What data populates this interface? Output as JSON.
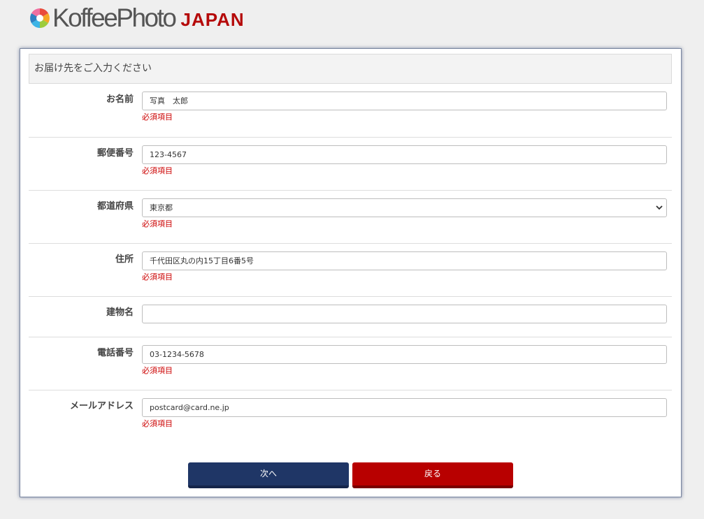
{
  "brand": {
    "logo_text": "KoffeePhoto",
    "logo_suffix": "JAPAN"
  },
  "form": {
    "header": "お届け先をご入力ください",
    "required_text": "必須項目",
    "fields": [
      {
        "label": "お名前",
        "value": "写真　太郎",
        "required": true
      },
      {
        "label": "郵便番号",
        "value": "123-4567",
        "required": true
      },
      {
        "label": "都道府県",
        "value": "東京都",
        "required": true,
        "type": "select"
      },
      {
        "label": "住所",
        "value": "千代田区丸の内15丁目6番5号",
        "required": true
      },
      {
        "label": "建物名",
        "value": "",
        "required": false
      },
      {
        "label": "電話番号",
        "value": "03-1234-5678",
        "required": true
      },
      {
        "label": "メールアドレス",
        "value": "postcard@card.ne.jp",
        "required": true
      }
    ]
  },
  "buttons": {
    "next_label": "次へ",
    "back_label": "戻る"
  },
  "colors": {
    "brand_red": "#b50a0a",
    "next_button": "#1f3666",
    "back_button": "#b80000",
    "required_red": "#cc0000"
  }
}
